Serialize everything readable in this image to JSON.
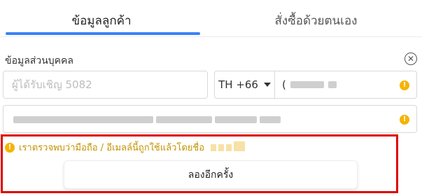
{
  "tabs": [
    {
      "label": "ข้อมูลลูกค้า",
      "active": true
    },
    {
      "label": "สั่งซื้อด้วยตนเอง",
      "active": false
    }
  ],
  "accent_color": "#3b82f6",
  "warning_color": "#f5b400",
  "error_border_color": "#e00000",
  "section": {
    "title": "ข้อมูลส่วนบุคคล",
    "close_icon": "close-circle-icon"
  },
  "invite": {
    "placeholder": "ผู้ได้รับเชิญ 5082",
    "value": ""
  },
  "phone": {
    "country_code": "TH +66",
    "prefix": "(",
    "value_redacted": true,
    "warning_icon": "warning-icon"
  },
  "email": {
    "value_redacted": true,
    "warning_icon": "warning-icon"
  },
  "alert": {
    "message": "เราตรวจพบว่ามือถือ / อีเมลล์นี้ถูกใช้แล้วโดยชื่อ",
    "icon": "warning-icon"
  },
  "retry_button": {
    "label": "ลองอีกครั้ง"
  }
}
